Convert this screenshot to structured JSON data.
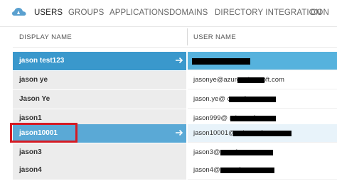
{
  "nav": {
    "logo_icon": "azure-active-directory-icon",
    "tabs": [
      {
        "label": "USERS",
        "active": true
      },
      {
        "label": "GROUPS",
        "active": false
      },
      {
        "label": "APPLICATIONS",
        "active": false
      },
      {
        "label": "DOMAINS",
        "active": false
      },
      {
        "label": "DIRECTORY INTEGRATION",
        "active": false
      },
      {
        "label": "CON",
        "active": false
      }
    ]
  },
  "table": {
    "columns": [
      "DISPLAY NAME",
      "USER NAME"
    ],
    "rows": [
      {
        "display_name": "jason test123",
        "user_name": "",
        "state": "selected"
      },
      {
        "display_name": "jason ye",
        "user_name": "jasonye@azure                 microsoft.com",
        "state": "normal"
      },
      {
        "display_name": "Jason Ye",
        "user_name": "jason.ye@                          crosoft.com",
        "state": "normal"
      },
      {
        "display_name": "jason1",
        "user_name": "jason999@                          microsoft.com",
        "state": "normal"
      },
      {
        "display_name": "jason10001",
        "user_name": "jason10001@                          microsoft.com",
        "state": "hover"
      },
      {
        "display_name": "jason3",
        "user_name": "jason3@                          rosoft.com",
        "state": "normal"
      },
      {
        "display_name": "jason4",
        "user_name": "jason4@                          crosoft.com",
        "state": "normal"
      }
    ]
  },
  "colors": {
    "selected_row": "#3a98cc",
    "selected_user_cell": "#56b2dd",
    "hover_row": "#5aa9d6",
    "highlight_border": "#d51b24"
  }
}
